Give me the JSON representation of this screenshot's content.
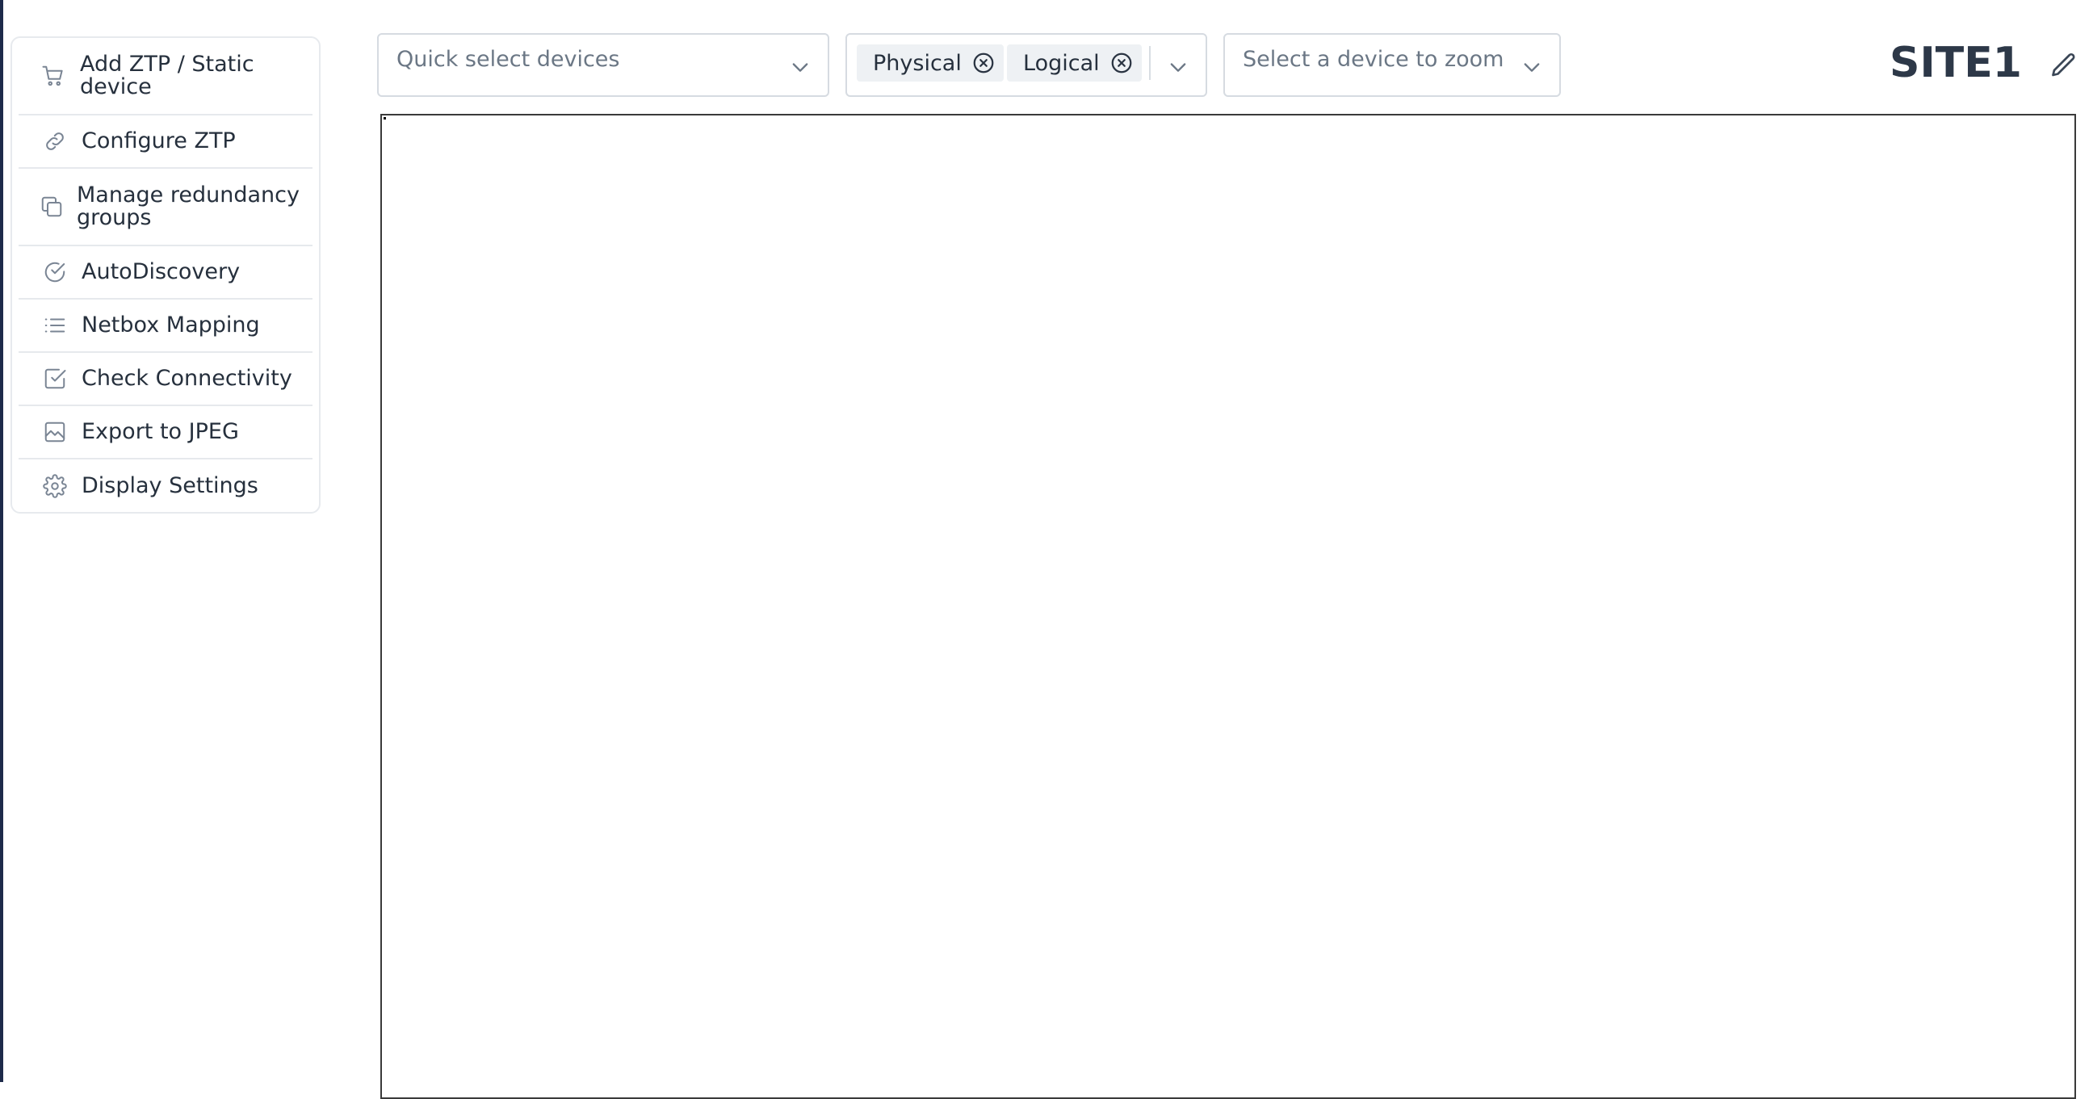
{
  "sidebar": {
    "items": [
      {
        "label": "Add ZTP / Static device",
        "icon": "cart-icon"
      },
      {
        "label": "Configure ZTP",
        "icon": "link-icon"
      },
      {
        "label": "Manage redundancy groups",
        "icon": "copy-icon"
      },
      {
        "label": "AutoDiscovery",
        "icon": "check-circle-icon"
      },
      {
        "label": "Netbox Mapping",
        "icon": "list-icon"
      },
      {
        "label": "Check Connectivity",
        "icon": "check-square-icon"
      },
      {
        "label": "Export to JPEG",
        "icon": "image-icon"
      },
      {
        "label": "Display Settings",
        "icon": "gear-icon"
      }
    ]
  },
  "toolbar": {
    "quick_select": {
      "placeholder": "Quick select devices"
    },
    "layers": {
      "chips": [
        {
          "label": "Physical"
        },
        {
          "label": "Logical"
        }
      ]
    },
    "zoom_select": {
      "placeholder": "Select a device to zoom"
    }
  },
  "header": {
    "site_name": "SITE1",
    "edit_icon": "pencil-icon"
  },
  "colors": {
    "text": "#26303d",
    "muted": "#6b7785",
    "border": "#d6dbe1",
    "chip_bg": "#eef1f4",
    "left_edge": "#1e2a4a"
  }
}
